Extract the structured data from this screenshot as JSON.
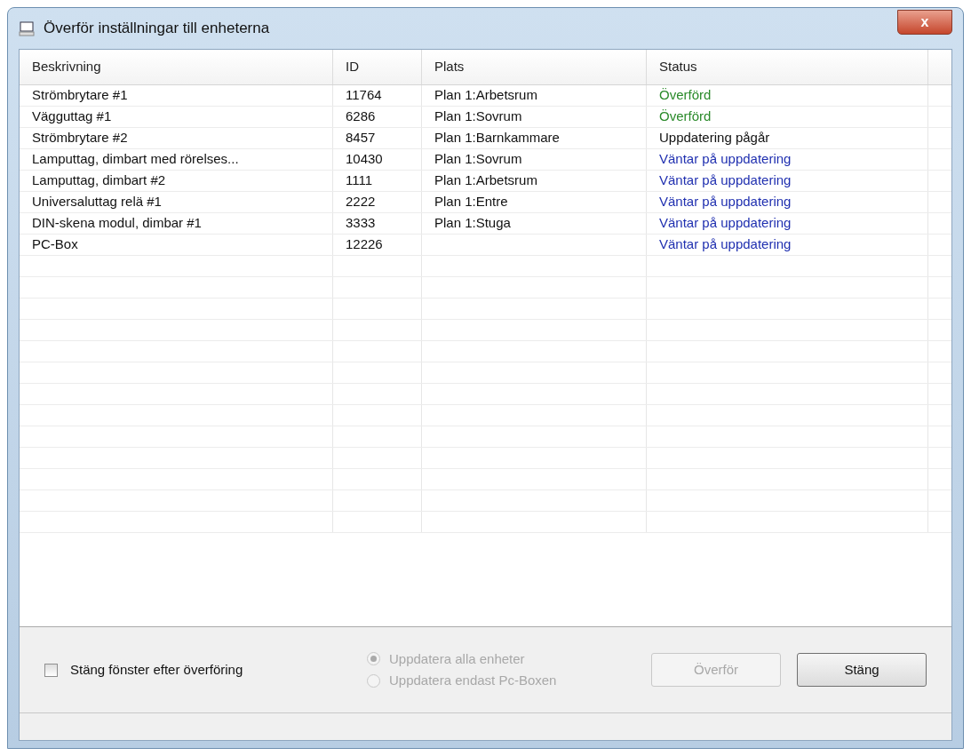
{
  "window": {
    "title": "Överför inställningar till enheterna",
    "close": "x"
  },
  "table": {
    "columns": [
      "Beskrivning",
      "ID",
      "Plats",
      "Status"
    ],
    "rows": [
      {
        "cells": [
          "Strömbrytare #1",
          "11764",
          "Plan 1:Arbetsrum",
          "Överförd"
        ],
        "kind": "done"
      },
      {
        "cells": [
          "Vägguttag #1",
          "6286",
          "Plan 1:Sovrum",
          "Överförd"
        ],
        "kind": "done"
      },
      {
        "cells": [
          "Strömbrytare #2",
          "8457",
          "Plan 1:Barnkammare",
          "Uppdatering pågår"
        ],
        "kind": "progress"
      },
      {
        "cells": [
          "Lamputtag, dimbart med rörelses...",
          "10430",
          "Plan 1:Sovrum",
          "Väntar på uppdatering"
        ],
        "kind": "waiting"
      },
      {
        "cells": [
          "Lamputtag, dimbart #2",
          "1111",
          "Plan 1:Arbetsrum",
          "Väntar på uppdatering"
        ],
        "kind": "waiting"
      },
      {
        "cells": [
          "Universaluttag relä #1",
          "2222",
          "Plan 1:Entre",
          "Väntar på uppdatering"
        ],
        "kind": "waiting"
      },
      {
        "cells": [
          "DIN-skena modul, dimbar #1",
          "3333",
          "Plan 1:Stuga",
          "Väntar på uppdatering"
        ],
        "kind": "waiting"
      },
      {
        "cells": [
          "PC-Box",
          "12226",
          "",
          "Väntar på uppdatering"
        ],
        "kind": "waiting"
      }
    ]
  },
  "close_after_transfer": {
    "label": "Stäng fönster efter överföring",
    "checked": false
  },
  "update_options": [
    {
      "label": "Uppdatera alla enheter",
      "selected": true,
      "disabled": true
    },
    {
      "label": "Uppdatera endast Pc-Boxen",
      "selected": false,
      "disabled": true
    }
  ],
  "buttons": [
    {
      "label": "Överför",
      "disabled": true
    },
    {
      "label": "Stäng",
      "disabled": false
    }
  ]
}
